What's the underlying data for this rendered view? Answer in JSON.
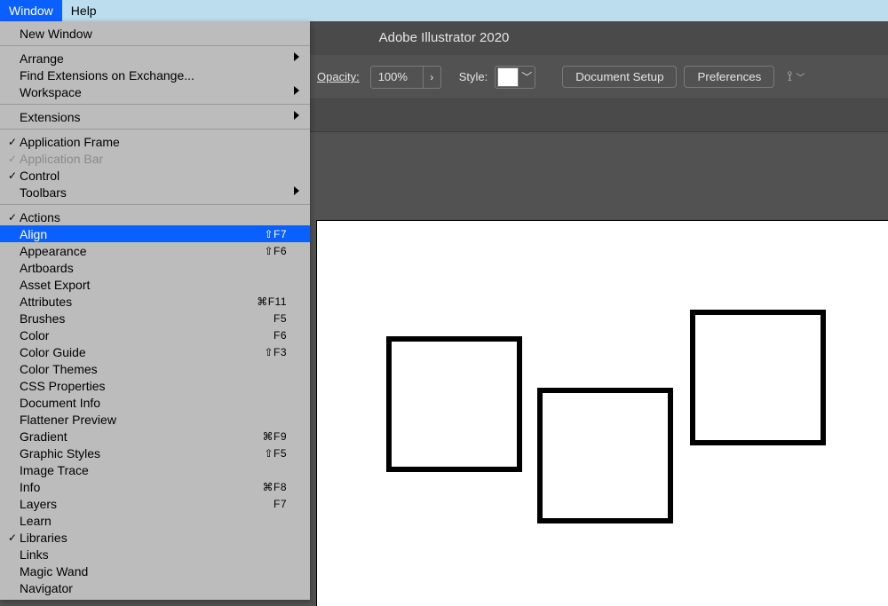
{
  "menubar": {
    "window": "Window",
    "help": "Help"
  },
  "app_title": "Adobe Illustrator 2020",
  "controlbar": {
    "opacity_label": "Opacity:",
    "opacity_value": "100%",
    "style_label": "Style:",
    "doc_setup": "Document Setup",
    "preferences": "Preferences"
  },
  "dropdown": {
    "groups": [
      [
        {
          "label": "New Window"
        }
      ],
      [
        {
          "label": "Arrange",
          "submenu": true
        },
        {
          "label": "Find Extensions on Exchange..."
        },
        {
          "label": "Workspace",
          "submenu": true
        }
      ],
      [
        {
          "label": "Extensions",
          "submenu": true
        }
      ],
      [
        {
          "label": "Application Frame",
          "checked": true
        },
        {
          "label": "Application Bar",
          "checked": true,
          "disabled": true
        },
        {
          "label": "Control",
          "checked": true
        },
        {
          "label": "Toolbars",
          "submenu": true
        }
      ],
      [
        {
          "label": "Actions",
          "checked": true
        },
        {
          "label": "Align",
          "shortcut": "⇧F7",
          "highlight": true
        },
        {
          "label": "Appearance",
          "shortcut": "⇧F6"
        },
        {
          "label": "Artboards"
        },
        {
          "label": "Asset Export"
        },
        {
          "label": "Attributes",
          "shortcut": "⌘F11"
        },
        {
          "label": "Brushes",
          "shortcut": "F5"
        },
        {
          "label": "Color",
          "shortcut": "F6"
        },
        {
          "label": "Color Guide",
          "shortcut": "⇧F3"
        },
        {
          "label": "Color Themes"
        },
        {
          "label": "CSS Properties"
        },
        {
          "label": "Document Info"
        },
        {
          "label": "Flattener Preview"
        },
        {
          "label": "Gradient",
          "shortcut": "⌘F9"
        },
        {
          "label": "Graphic Styles",
          "shortcut": "⇧F5"
        },
        {
          "label": "Image Trace"
        },
        {
          "label": "Info",
          "shortcut": "⌘F8"
        },
        {
          "label": "Layers",
          "shortcut": "F7"
        },
        {
          "label": "Learn"
        },
        {
          "label": "Libraries",
          "checked": true
        },
        {
          "label": "Links"
        },
        {
          "label": "Magic Wand"
        },
        {
          "label": "Navigator"
        }
      ]
    ]
  }
}
